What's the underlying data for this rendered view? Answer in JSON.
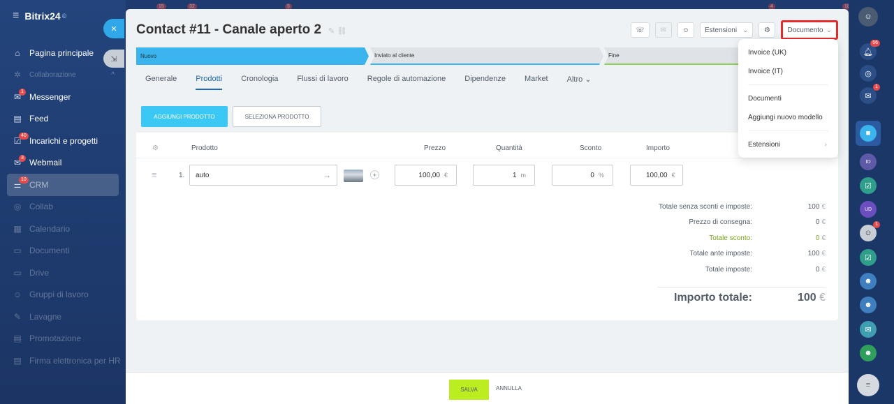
{
  "app": {
    "logo": "Bitrix24",
    "logo_mark": "©"
  },
  "top_badges": [
    "15",
    "32",
    "5",
    "4",
    "18"
  ],
  "sidebar": {
    "items": [
      {
        "label": "Pagina principale",
        "icon": "home-icon"
      },
      {
        "label": "Collaborazione",
        "icon": "collab-icon"
      },
      {
        "label": "Messenger",
        "icon": "chat-icon",
        "badge": "1"
      },
      {
        "label": "Feed",
        "icon": "feed-icon"
      },
      {
        "label": "Incarichi e progetti",
        "icon": "tasks-icon",
        "badge": "40"
      },
      {
        "label": "Webmail",
        "icon": "mail-icon",
        "badge": "3"
      },
      {
        "label": "CRM",
        "icon": "crm-icon",
        "badge": "10"
      },
      {
        "label": "Collab",
        "icon": "collab-circle-icon"
      },
      {
        "label": "Calendario",
        "icon": "calendar-icon"
      },
      {
        "label": "Documenti",
        "icon": "documents-icon"
      },
      {
        "label": "Drive",
        "icon": "drive-icon"
      },
      {
        "label": "Gruppi di lavoro",
        "icon": "groups-icon"
      },
      {
        "label": "Lavagne",
        "icon": "boards-icon"
      },
      {
        "label": "Promotazione",
        "icon": "promo-icon"
      },
      {
        "label": "Firma elettronica per HR",
        "icon": "signature-icon"
      }
    ]
  },
  "rightbar": {
    "badges": {
      "notifications": "56",
      "chat": "1",
      "avatar": "1"
    },
    "initials": [
      "ID",
      "UD"
    ]
  },
  "header": {
    "title": "Contact #11 - Canale aperto 2",
    "extensions_label": "Estensioni",
    "document_label": "Documento"
  },
  "stages": [
    "Nuovo",
    "Inviato al cliente",
    "Fine"
  ],
  "tabs": [
    "Generale",
    "Prodotti",
    "Cronologia",
    "Flussi di lavoro",
    "Regole di automazione",
    "Dipendenze",
    "Market",
    "Altro"
  ],
  "active_tab": "Prodotti",
  "products": {
    "add_label": "AGGIUNGI PRODOTTO",
    "select_label": "SELEZIONA PRODOTTO",
    "columns": [
      "Prodotto",
      "Prezzo",
      "Quantità",
      "Sconto",
      "Importo"
    ],
    "rows": [
      {
        "index": "1.",
        "name": "auto",
        "price": "100,00",
        "price_unit": "€",
        "qty": "1",
        "qty_unit": "m",
        "discount": "0",
        "discount_unit": "%",
        "amount": "100,00",
        "amount_unit": "€"
      }
    ]
  },
  "totals": {
    "lines": [
      {
        "label": "Totale senza sconti e imposte:",
        "value": "100",
        "currency": "€"
      },
      {
        "label": "Prezzo di consegna:",
        "value": "0",
        "currency": "€"
      },
      {
        "label": "Totale sconto:",
        "value": "0",
        "currency": "€"
      },
      {
        "label": "Totale ante imposte:",
        "value": "100",
        "currency": "€"
      },
      {
        "label": "Totale imposte:",
        "value": "0",
        "currency": "€"
      }
    ],
    "grand_label": "Importo totale:",
    "grand_value": "100",
    "grand_currency": "€"
  },
  "footer": {
    "save": "SALVA",
    "cancel": "ANNULLA"
  },
  "dropdown": {
    "items": [
      "Invoice (UK)",
      "Invoice (IT)",
      "Documenti",
      "Aggiungi nuovo modello",
      "Estensioni"
    ]
  },
  "colors": {
    "accent": "#3bc8f5",
    "save": "#bbed21",
    "highlight": "#e52b2b",
    "link": "#2067b0"
  }
}
